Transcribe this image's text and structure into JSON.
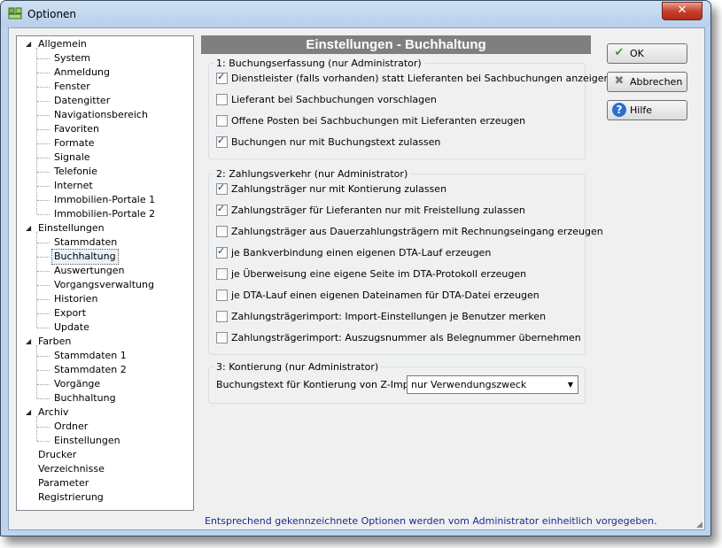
{
  "window": {
    "title": "Optionen",
    "close_glyph": "✕",
    "app_icon": "app-icon"
  },
  "tree": {
    "items": [
      {
        "label": "Allgemein",
        "level": 0,
        "expanded": true
      },
      {
        "label": "System",
        "level": 1
      },
      {
        "label": "Anmeldung",
        "level": 1
      },
      {
        "label": "Fenster",
        "level": 1
      },
      {
        "label": "Datengitter",
        "level": 1
      },
      {
        "label": "Navigationsbereich",
        "level": 1
      },
      {
        "label": "Favoriten",
        "level": 1
      },
      {
        "label": "Formate",
        "level": 1
      },
      {
        "label": "Signale",
        "level": 1
      },
      {
        "label": "Telefonie",
        "level": 1
      },
      {
        "label": "Internet",
        "level": 1
      },
      {
        "label": "Immobilien-Portale 1",
        "level": 1
      },
      {
        "label": "Immobilien-Portale 2",
        "level": 1
      },
      {
        "label": "Einstellungen",
        "level": 0,
        "expanded": true
      },
      {
        "label": "Stammdaten",
        "level": 1
      },
      {
        "label": "Buchhaltung",
        "level": 1,
        "selected": true
      },
      {
        "label": "Auswertungen",
        "level": 1
      },
      {
        "label": "Vorgangsverwaltung",
        "level": 1
      },
      {
        "label": "Historien",
        "level": 1
      },
      {
        "label": "Export",
        "level": 1
      },
      {
        "label": "Update",
        "level": 1
      },
      {
        "label": "Farben",
        "level": 0,
        "expanded": true
      },
      {
        "label": "Stammdaten 1",
        "level": 1
      },
      {
        "label": "Stammdaten 2",
        "level": 1
      },
      {
        "label": "Vorgänge",
        "level": 1
      },
      {
        "label": "Buchhaltung",
        "level": 1
      },
      {
        "label": "Archiv",
        "level": 0,
        "expanded": true
      },
      {
        "label": "Ordner",
        "level": 1
      },
      {
        "label": "Einstellungen",
        "level": 1
      },
      {
        "label": "Drucker",
        "level": 0
      },
      {
        "label": "Verzeichnisse",
        "level": 0
      },
      {
        "label": "Parameter",
        "level": 0
      },
      {
        "label": "Registrierung",
        "level": 0
      }
    ]
  },
  "panel": {
    "header": "Einstellungen - Buchhaltung",
    "groups": [
      {
        "title": "1: Buchungserfassung  (nur Administrator)",
        "options": [
          {
            "label": "Dienstleister (falls vorhanden) statt Lieferanten bei Sachbuchungen anzeigen",
            "checked": true
          },
          {
            "label": "Lieferant bei Sachbuchungen vorschlagen",
            "checked": false
          },
          {
            "label": "Offene Posten bei Sachbuchungen mit Lieferanten erzeugen",
            "checked": false
          },
          {
            "label": "Buchungen nur mit Buchungstext zulassen",
            "checked": true
          }
        ]
      },
      {
        "title": "2: Zahlungsverkehr  (nur Administrator)",
        "options": [
          {
            "label": "Zahlungsträger nur mit Kontierung zulassen",
            "checked": true
          },
          {
            "label": "Zahlungsträger für Lieferanten nur mit Freistellung zulassen",
            "checked": true
          },
          {
            "label": "Zahlungsträger aus Dauerzahlungsträgern mit Rechnungseingang erzeugen",
            "checked": false
          },
          {
            "label": "je Bankverbindung einen eigenen DTA-Lauf erzeugen",
            "checked": true
          },
          {
            "label": "je Überweisung eine eigene Seite im DTA-Protokoll erzeugen",
            "checked": false
          },
          {
            "label": "je DTA-Lauf einen eigenen Dateinamen für DTA-Datei erzeugen",
            "checked": false
          },
          {
            "label": "Zahlungsträgerimport: Import-Einstellungen je Benutzer merken",
            "checked": false
          },
          {
            "label": "Zahlungsträgerimport: Auszugsnummer als Belegnummer übernehmen",
            "checked": false
          }
        ]
      },
      {
        "title": "3: Kontierung  (nur Administrator)",
        "field_label": "Buchungstext für Kontierung von Z-Importen:",
        "select_value": "nur Verwendungszweck"
      }
    ],
    "footer": "Entsprechend gekennzeichnete Optionen werden vom Administrator einheitlich vorgegeben."
  },
  "buttons": {
    "ok": {
      "label": "OK",
      "icon": "checkmark-icon"
    },
    "cancel": {
      "label": "Abbrechen",
      "icon": "cancel-icon"
    },
    "help": {
      "label": "Hilfe",
      "icon": "help-icon"
    }
  }
}
